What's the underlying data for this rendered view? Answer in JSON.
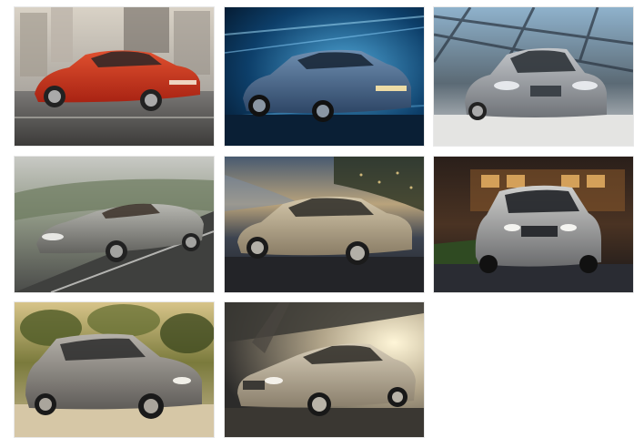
{
  "gallery": {
    "photos": [
      {
        "subject": "red-coupe",
        "body_color": "#c8331f",
        "scene": "city-street"
      },
      {
        "subject": "blue-sedan",
        "body_color": "#3f5f86",
        "scene": "blue-light-studio"
      },
      {
        "subject": "silver-sedan",
        "body_color": "#9a9ea3",
        "scene": "glass-canopy"
      },
      {
        "subject": "convertible",
        "body_color": "#8e8e88",
        "scene": "coastal-road"
      },
      {
        "subject": "champagne-sedan",
        "body_color": "#b6a98e",
        "scene": "river-dusk"
      },
      {
        "subject": "suv-night",
        "body_color": "#a9aaa8",
        "scene": "night-building"
      },
      {
        "subject": "suv-countryside",
        "body_color": "#8f8b86",
        "scene": "countryside"
      },
      {
        "subject": "luxury-sedan",
        "body_color": "#b8ab94",
        "scene": "bridge-sunlight"
      }
    ]
  }
}
